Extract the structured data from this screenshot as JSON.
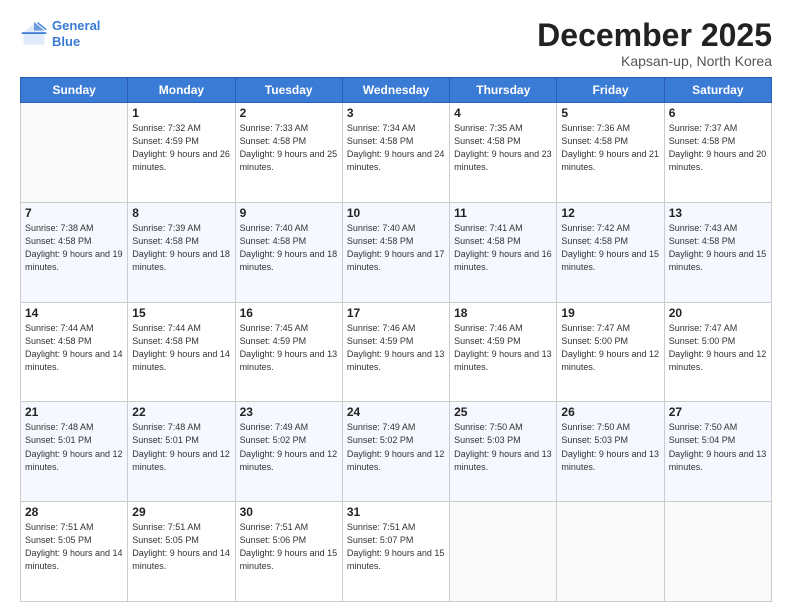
{
  "header": {
    "logo_line1": "General",
    "logo_line2": "Blue",
    "month": "December 2025",
    "location": "Kapsan-up, North Korea"
  },
  "days_of_week": [
    "Sunday",
    "Monday",
    "Tuesday",
    "Wednesday",
    "Thursday",
    "Friday",
    "Saturday"
  ],
  "weeks": [
    [
      {
        "day": "",
        "sunrise": "",
        "sunset": "",
        "daylight": ""
      },
      {
        "day": "1",
        "sunrise": "7:32 AM",
        "sunset": "4:59 PM",
        "daylight": "9 hours and 26 minutes."
      },
      {
        "day": "2",
        "sunrise": "7:33 AM",
        "sunset": "4:58 PM",
        "daylight": "9 hours and 25 minutes."
      },
      {
        "day": "3",
        "sunrise": "7:34 AM",
        "sunset": "4:58 PM",
        "daylight": "9 hours and 24 minutes."
      },
      {
        "day": "4",
        "sunrise": "7:35 AM",
        "sunset": "4:58 PM",
        "daylight": "9 hours and 23 minutes."
      },
      {
        "day": "5",
        "sunrise": "7:36 AM",
        "sunset": "4:58 PM",
        "daylight": "9 hours and 21 minutes."
      },
      {
        "day": "6",
        "sunrise": "7:37 AM",
        "sunset": "4:58 PM",
        "daylight": "9 hours and 20 minutes."
      }
    ],
    [
      {
        "day": "7",
        "sunrise": "7:38 AM",
        "sunset": "4:58 PM",
        "daylight": "9 hours and 19 minutes."
      },
      {
        "day": "8",
        "sunrise": "7:39 AM",
        "sunset": "4:58 PM",
        "daylight": "9 hours and 18 minutes."
      },
      {
        "day": "9",
        "sunrise": "7:40 AM",
        "sunset": "4:58 PM",
        "daylight": "9 hours and 18 minutes."
      },
      {
        "day": "10",
        "sunrise": "7:40 AM",
        "sunset": "4:58 PM",
        "daylight": "9 hours and 17 minutes."
      },
      {
        "day": "11",
        "sunrise": "7:41 AM",
        "sunset": "4:58 PM",
        "daylight": "9 hours and 16 minutes."
      },
      {
        "day": "12",
        "sunrise": "7:42 AM",
        "sunset": "4:58 PM",
        "daylight": "9 hours and 15 minutes."
      },
      {
        "day": "13",
        "sunrise": "7:43 AM",
        "sunset": "4:58 PM",
        "daylight": "9 hours and 15 minutes."
      }
    ],
    [
      {
        "day": "14",
        "sunrise": "7:44 AM",
        "sunset": "4:58 PM",
        "daylight": "9 hours and 14 minutes."
      },
      {
        "day": "15",
        "sunrise": "7:44 AM",
        "sunset": "4:58 PM",
        "daylight": "9 hours and 14 minutes."
      },
      {
        "day": "16",
        "sunrise": "7:45 AM",
        "sunset": "4:59 PM",
        "daylight": "9 hours and 13 minutes."
      },
      {
        "day": "17",
        "sunrise": "7:46 AM",
        "sunset": "4:59 PM",
        "daylight": "9 hours and 13 minutes."
      },
      {
        "day": "18",
        "sunrise": "7:46 AM",
        "sunset": "4:59 PM",
        "daylight": "9 hours and 13 minutes."
      },
      {
        "day": "19",
        "sunrise": "7:47 AM",
        "sunset": "5:00 PM",
        "daylight": "9 hours and 12 minutes."
      },
      {
        "day": "20",
        "sunrise": "7:47 AM",
        "sunset": "5:00 PM",
        "daylight": "9 hours and 12 minutes."
      }
    ],
    [
      {
        "day": "21",
        "sunrise": "7:48 AM",
        "sunset": "5:01 PM",
        "daylight": "9 hours and 12 minutes."
      },
      {
        "day": "22",
        "sunrise": "7:48 AM",
        "sunset": "5:01 PM",
        "daylight": "9 hours and 12 minutes."
      },
      {
        "day": "23",
        "sunrise": "7:49 AM",
        "sunset": "5:02 PM",
        "daylight": "9 hours and 12 minutes."
      },
      {
        "day": "24",
        "sunrise": "7:49 AM",
        "sunset": "5:02 PM",
        "daylight": "9 hours and 12 minutes."
      },
      {
        "day": "25",
        "sunrise": "7:50 AM",
        "sunset": "5:03 PM",
        "daylight": "9 hours and 13 minutes."
      },
      {
        "day": "26",
        "sunrise": "7:50 AM",
        "sunset": "5:03 PM",
        "daylight": "9 hours and 13 minutes."
      },
      {
        "day": "27",
        "sunrise": "7:50 AM",
        "sunset": "5:04 PM",
        "daylight": "9 hours and 13 minutes."
      }
    ],
    [
      {
        "day": "28",
        "sunrise": "7:51 AM",
        "sunset": "5:05 PM",
        "daylight": "9 hours and 14 minutes."
      },
      {
        "day": "29",
        "sunrise": "7:51 AM",
        "sunset": "5:05 PM",
        "daylight": "9 hours and 14 minutes."
      },
      {
        "day": "30",
        "sunrise": "7:51 AM",
        "sunset": "5:06 PM",
        "daylight": "9 hours and 15 minutes."
      },
      {
        "day": "31",
        "sunrise": "7:51 AM",
        "sunset": "5:07 PM",
        "daylight": "9 hours and 15 minutes."
      },
      {
        "day": "",
        "sunrise": "",
        "sunset": "",
        "daylight": ""
      },
      {
        "day": "",
        "sunrise": "",
        "sunset": "",
        "daylight": ""
      },
      {
        "day": "",
        "sunrise": "",
        "sunset": "",
        "daylight": ""
      }
    ]
  ],
  "labels": {
    "sunrise_prefix": "Sunrise: ",
    "sunset_prefix": "Sunset: ",
    "daylight_prefix": "Daylight: "
  }
}
